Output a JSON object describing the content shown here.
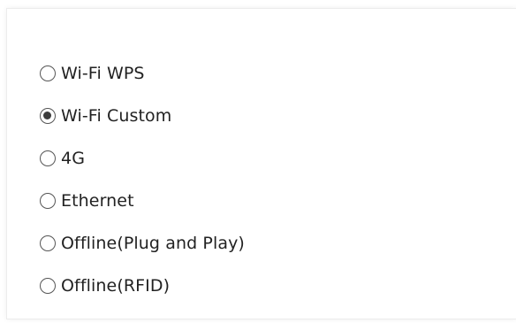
{
  "connection_options": [
    {
      "label": "Wi-Fi WPS",
      "checked": false
    },
    {
      "label": "Wi-Fi Custom",
      "checked": true
    },
    {
      "label": "4G",
      "checked": false
    },
    {
      "label": "Ethernet",
      "checked": false
    },
    {
      "label": "Offline(Plug and Play)",
      "checked": false
    },
    {
      "label": "Offline(RFID)",
      "checked": false
    }
  ]
}
